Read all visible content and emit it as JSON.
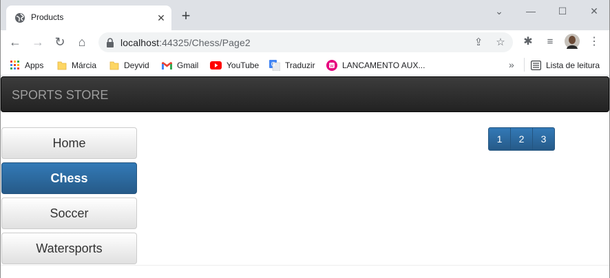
{
  "browser": {
    "tab_title": "Products",
    "url_host": "localhost",
    "url_rest": ":44325/Chess/Page2"
  },
  "bookmarks": [
    {
      "label": "Apps",
      "icon": "apps-grid-icon"
    },
    {
      "label": "Márcia",
      "icon": "folder-icon"
    },
    {
      "label": "Deyvid",
      "icon": "folder-icon"
    },
    {
      "label": "Gmail",
      "icon": "gmail-icon"
    },
    {
      "label": "YouTube",
      "icon": "youtube-icon"
    },
    {
      "label": "Traduzir",
      "icon": "translate-icon"
    },
    {
      "label": "LANCAMENTO AUX...",
      "icon": "wamp-icon"
    }
  ],
  "reading_list": "Lista de leitura",
  "site": {
    "brand": "SPORTS STORE",
    "categories": [
      {
        "label": "Home",
        "active": false
      },
      {
        "label": "Chess",
        "active": true
      },
      {
        "label": "Soccer",
        "active": false
      },
      {
        "label": "Watersports",
        "active": false
      }
    ],
    "pages": [
      "1",
      "2",
      "3"
    ]
  },
  "colors": {
    "primary": "#337ab7",
    "navbar": "#222222",
    "brand_text": "#9d9d9d"
  }
}
